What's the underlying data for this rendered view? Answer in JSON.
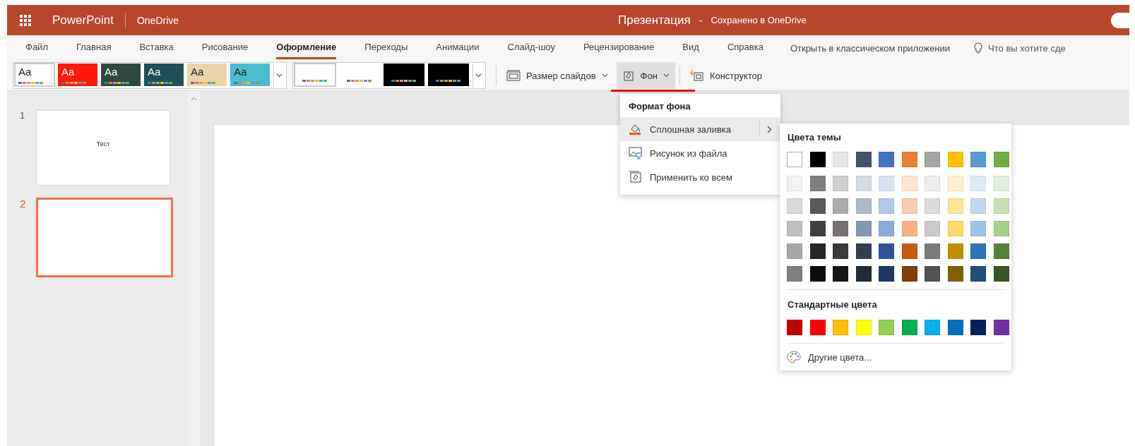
{
  "title_bar": {
    "app_name": "PowerPoint",
    "location": "OneDrive",
    "document": "Презентация",
    "separator": "-",
    "save_status": "Сохранено в OneDrive"
  },
  "tabs": [
    {
      "label": "Файл",
      "selected": false
    },
    {
      "label": "Главная",
      "selected": false
    },
    {
      "label": "Вставка",
      "selected": false
    },
    {
      "label": "Рисование",
      "selected": false
    },
    {
      "label": "Оформление",
      "selected": true
    },
    {
      "label": "Переходы",
      "selected": false
    },
    {
      "label": "Анимации",
      "selected": false
    },
    {
      "label": "Слайд-шоу",
      "selected": false
    },
    {
      "label": "Рецензирование",
      "selected": false
    },
    {
      "label": "Вид",
      "selected": false
    },
    {
      "label": "Справка",
      "selected": false
    }
  ],
  "open_desktop": "Открыть в классическом приложении",
  "tell_me": "Что вы хотите сде",
  "ribbon": {
    "themes": [
      {
        "label": "Aa",
        "color": "#ffffff",
        "selected": true
      },
      {
        "label": "Aa",
        "color": "#ff1a0a",
        "selected": false
      },
      {
        "label": "Aa",
        "color": "#2e4a3f",
        "selected": false
      },
      {
        "label": "Aa",
        "color": "#1f5059",
        "selected": false
      },
      {
        "label": "Aa",
        "color": "#ead3a6",
        "selected": false
      },
      {
        "label": "Aa",
        "color": "#4cbbd1",
        "selected": false
      }
    ],
    "variants": [
      {
        "color": "#ffffff",
        "selected": true
      },
      {
        "color": "#ffffff",
        "selected": false
      },
      {
        "color": "#000000",
        "selected": false
      },
      {
        "color": "#000000",
        "selected": false
      }
    ],
    "slide_size": "Размер слайдов",
    "background": {
      "label": "Фон",
      "expanded": true
    },
    "designer": "Конструктор"
  },
  "slides": [
    {
      "number": "1",
      "title": "Тест",
      "selected": false
    },
    {
      "number": "2",
      "selected": true
    }
  ],
  "background_menu": {
    "title": "Формат фона",
    "items": [
      {
        "label": "Сплошная заливка",
        "kind": "fill",
        "has_submenu": true,
        "selected": true
      },
      {
        "label": "Рисунок из файла",
        "kind": "picture",
        "has_submenu": false,
        "selected": false
      },
      {
        "label": "Применить ко всем",
        "kind": "apply",
        "has_submenu": false,
        "selected": false
      }
    ]
  },
  "color_menu": {
    "theme_title": "Цвета темы",
    "theme_colors": [
      [
        {
          "color": "#ffffff"
        },
        {
          "color": "#000000"
        },
        {
          "color": "#e7e6e6"
        },
        {
          "color": "#44546a"
        },
        {
          "color": "#4472c4"
        },
        {
          "color": "#ed7d31"
        },
        {
          "color": "#a5a5a5"
        },
        {
          "color": "#ffc000"
        },
        {
          "color": "#5b9bd5"
        },
        {
          "color": "#70ad47"
        }
      ],
      [
        {
          "color": "#f2f2f2"
        },
        {
          "color": "#808080"
        },
        {
          "color": "#d0cece"
        },
        {
          "color": "#d6dce4"
        },
        {
          "color": "#d9e2f3"
        },
        {
          "color": "#fbe5d5"
        },
        {
          "color": "#ededed"
        },
        {
          "color": "#fff2cc"
        },
        {
          "color": "#deebf6"
        },
        {
          "color": "#e2efd9"
        }
      ],
      [
        {
          "color": "#d9d9d9"
        },
        {
          "color": "#595959"
        },
        {
          "color": "#aeaaaa"
        },
        {
          "color": "#adb9ca"
        },
        {
          "color": "#b4c6e7"
        },
        {
          "color": "#f7cbac"
        },
        {
          "color": "#dbdbdb"
        },
        {
          "color": "#fee599"
        },
        {
          "color": "#bdd7ee"
        },
        {
          "color": "#c5e0b3"
        }
      ],
      [
        {
          "color": "#bfbfbf"
        },
        {
          "color": "#404040"
        },
        {
          "color": "#757171"
        },
        {
          "color": "#8497b0"
        },
        {
          "color": "#8eaadb"
        },
        {
          "color": "#f4b183"
        },
        {
          "color": "#c9c9c9"
        },
        {
          "color": "#ffd966"
        },
        {
          "color": "#9dc3e6"
        },
        {
          "color": "#a8d08d"
        }
      ],
      [
        {
          "color": "#a6a6a6"
        },
        {
          "color": "#262626"
        },
        {
          "color": "#3b3838"
        },
        {
          "color": "#333f4f"
        },
        {
          "color": "#2f5496"
        },
        {
          "color": "#c55a11"
        },
        {
          "color": "#7b7b7b"
        },
        {
          "color": "#bf9000"
        },
        {
          "color": "#2e75b5"
        },
        {
          "color": "#538135"
        }
      ],
      [
        {
          "color": "#808080"
        },
        {
          "color": "#0d0d0d"
        },
        {
          "color": "#171616"
        },
        {
          "color": "#222a35"
        },
        {
          "color": "#1f3864"
        },
        {
          "color": "#843c0b"
        },
        {
          "color": "#525252"
        },
        {
          "color": "#7f6000"
        },
        {
          "color": "#1e4e79"
        },
        {
          "color": "#375623"
        }
      ]
    ],
    "standard_title": "Стандартные цвета",
    "standard_colors": [
      {
        "color": "#c00000"
      },
      {
        "color": "#ff0000"
      },
      {
        "color": "#ffc000"
      },
      {
        "color": "#ffff00"
      },
      {
        "color": "#92d050"
      },
      {
        "color": "#00b050"
      },
      {
        "color": "#00b0f0"
      },
      {
        "color": "#0070c0"
      },
      {
        "color": "#002060"
      },
      {
        "color": "#7030a0"
      }
    ],
    "more": "Другие цвета..."
  }
}
